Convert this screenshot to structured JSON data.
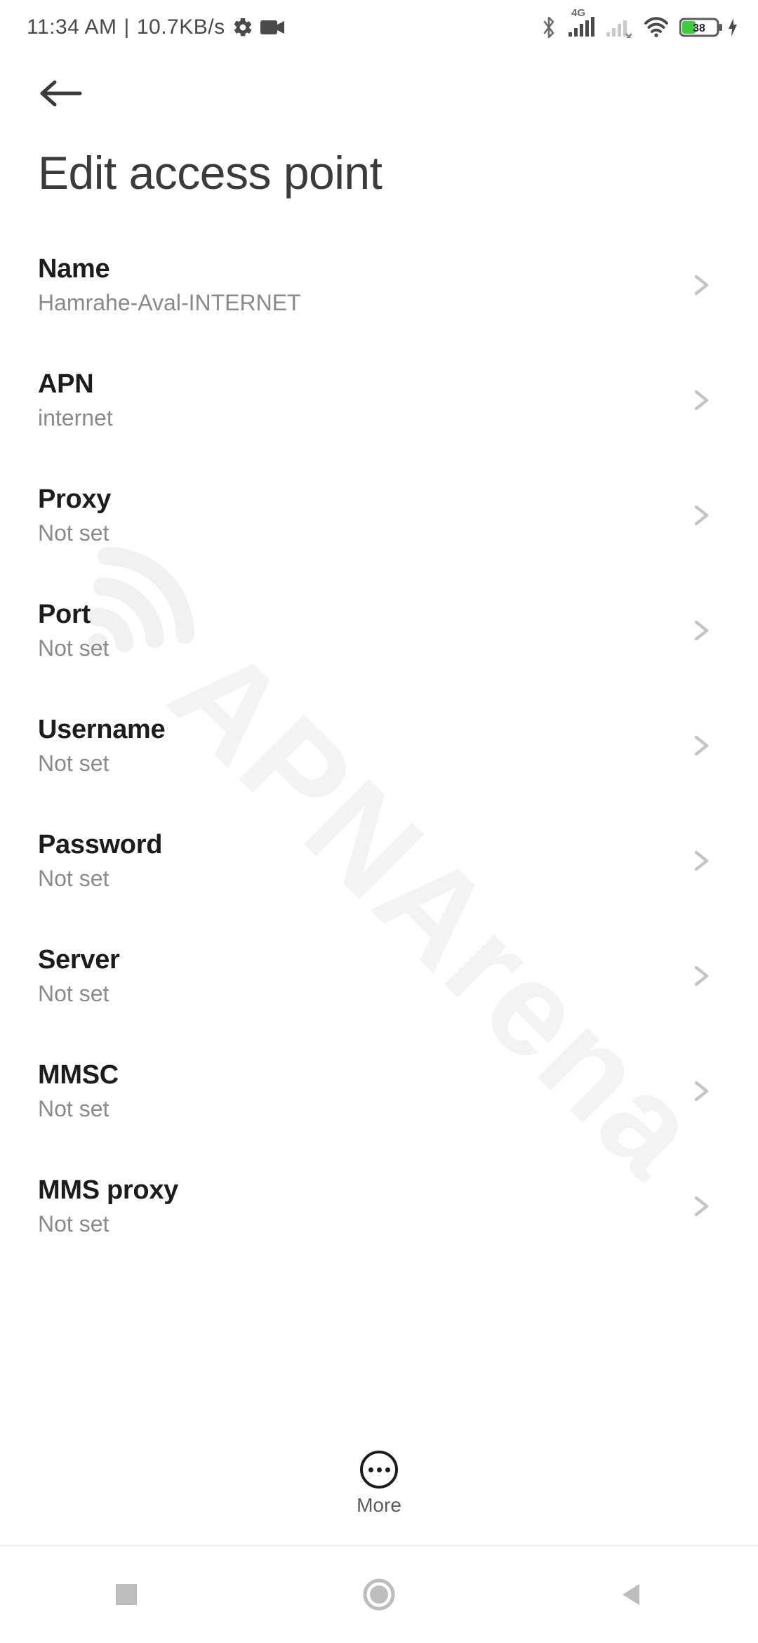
{
  "status_bar": {
    "time": "11:34 AM",
    "sep": " | ",
    "net_speed": "10.7KB/s",
    "battery_percent": "38",
    "signal_label_4g": "4G"
  },
  "header": {
    "title": "Edit access point"
  },
  "rows": [
    {
      "title": "Name",
      "value": "Hamrahe-Aval-INTERNET"
    },
    {
      "title": "APN",
      "value": "internet"
    },
    {
      "title": "Proxy",
      "value": "Not set"
    },
    {
      "title": "Port",
      "value": "Not set"
    },
    {
      "title": "Username",
      "value": "Not set"
    },
    {
      "title": "Password",
      "value": "Not set"
    },
    {
      "title": "Server",
      "value": "Not set"
    },
    {
      "title": "MMSC",
      "value": "Not set"
    },
    {
      "title": "MMS proxy",
      "value": "Not set"
    }
  ],
  "footer": {
    "more_label": "More"
  },
  "watermark": {
    "text": "APNArena"
  }
}
